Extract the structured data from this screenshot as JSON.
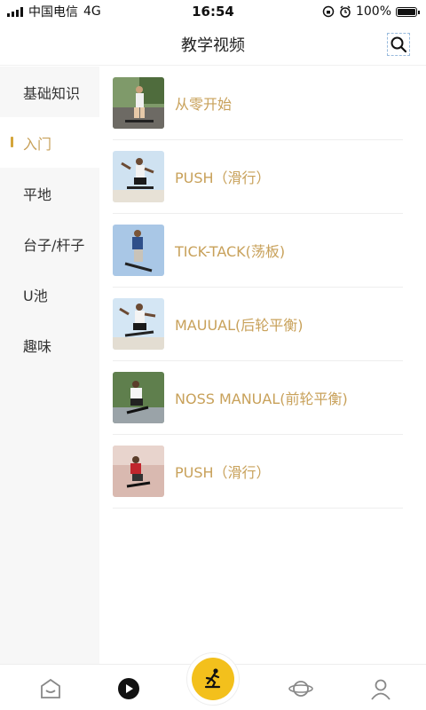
{
  "status": {
    "carrier": "中国电信",
    "network": "4G",
    "time": "16:54",
    "battery": "100%"
  },
  "nav": {
    "title": "教学视频"
  },
  "sidebar": {
    "items": [
      {
        "label": "基础知识"
      },
      {
        "label": "入门"
      },
      {
        "label": "平地"
      },
      {
        "label": "台子/杆子"
      },
      {
        "label": "U池"
      },
      {
        "label": "趣味"
      }
    ],
    "active": "入门"
  },
  "list": {
    "items": [
      {
        "title": "从零开始"
      },
      {
        "title": "PUSH（滑行）"
      },
      {
        "title": "TICK-TACK(荡板)"
      },
      {
        "title": "MAUUAL(后轮平衡)"
      },
      {
        "title": "NOSS MANUAL(前轮平衡)"
      },
      {
        "title": "PUSH（滑行）"
      }
    ]
  },
  "tabbar": {
    "icons": [
      "home-icon",
      "play-icon",
      "skater-icon",
      "planet-icon",
      "profile-icon"
    ]
  },
  "colors": {
    "accent": "#c8a15a",
    "fab": "#f3c01c"
  }
}
